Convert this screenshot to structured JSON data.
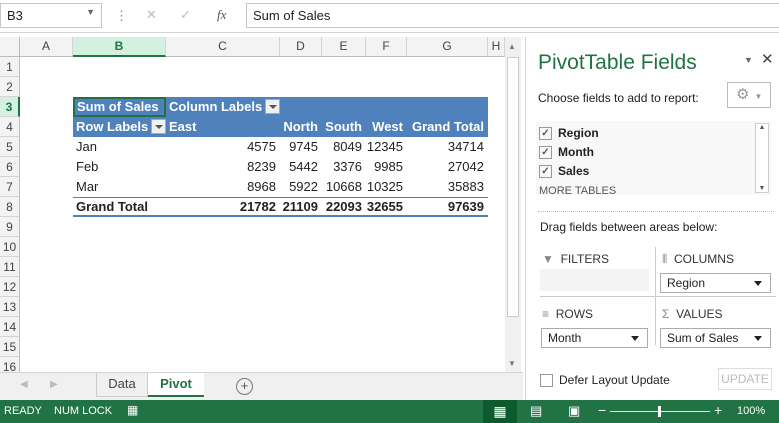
{
  "formula_bar": {
    "name_box": "B3",
    "cancel_icon": "✕",
    "enter_icon": "✓",
    "fx_label": "fx",
    "formula": "Sum of Sales"
  },
  "columns": [
    "A",
    "B",
    "C",
    "D",
    "E",
    "F",
    "G",
    "H"
  ],
  "rows": [
    "1",
    "2",
    "3",
    "4",
    "5",
    "6",
    "7",
    "8",
    "9",
    "10",
    "11",
    "12",
    "13",
    "14",
    "15",
    "16"
  ],
  "pivot": {
    "value_label": "Sum of Sales",
    "column_labels": "Column Labels",
    "row_labels": "Row Labels",
    "headers": [
      "East",
      "North",
      "South",
      "West",
      "Grand Total"
    ],
    "data": [
      {
        "label": "Jan",
        "values": [
          "4575",
          "9745",
          "8049",
          "12345",
          "34714"
        ]
      },
      {
        "label": "Feb",
        "values": [
          "8239",
          "5442",
          "3376",
          "9985",
          "27042"
        ]
      },
      {
        "label": "Mar",
        "values": [
          "8968",
          "5922",
          "10668",
          "10325",
          "35883"
        ]
      }
    ],
    "total": {
      "label": "Grand Total",
      "values": [
        "21782",
        "21109",
        "22093",
        "32655",
        "97639"
      ]
    }
  },
  "sheet_tabs": [
    {
      "label": "Data",
      "active": false
    },
    {
      "label": "Pivot",
      "active": true
    }
  ],
  "pane": {
    "title": "PivotTable Fields",
    "choose": "Choose fields to add to report:",
    "fields": [
      {
        "label": "Region",
        "checked": true
      },
      {
        "label": "Month",
        "checked": true
      },
      {
        "label": "Sales",
        "checked": true
      }
    ],
    "more_tables": "MORE TABLES",
    "drag": "Drag fields between areas below:",
    "filters": "FILTERS",
    "columns": "COLUMNS",
    "rows": "ROWS",
    "values": "VALUES",
    "columns_value": "Region",
    "rows_value": "Month",
    "values_value": "Sum of Sales",
    "defer": "Defer Layout Update",
    "update": "UPDATE"
  },
  "status": {
    "ready": "READY",
    "numlock": "NUM LOCK",
    "zoom": "100%"
  },
  "colors": {
    "accent": "#217346",
    "pivot_header": "#4f81bd"
  }
}
